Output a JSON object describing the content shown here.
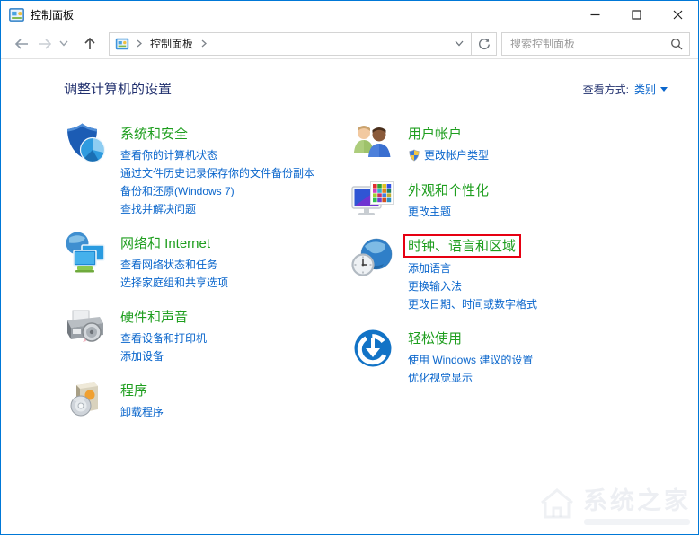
{
  "window": {
    "title": "控制面板"
  },
  "nav": {
    "breadcrumb_root": "控制面板",
    "search_placeholder": "搜索控制面板"
  },
  "header": {
    "title": "调整计算机的设置",
    "view_by_label": "查看方式:",
    "view_by_value": "类别"
  },
  "colors": {
    "accent_blue": "#0078d7",
    "category_green": "#1e9e1e",
    "link_blue": "#0a66cc",
    "heading_navy": "#21306e",
    "highlight_red": "#e60012"
  },
  "columns": {
    "left": [
      {
        "id": "system-security",
        "icon": "shield-security-icon",
        "title": "系统和安全",
        "links": [
          {
            "text": "查看你的计算机状态"
          },
          {
            "text": "通过文件历史记录保存你的文件备份副本"
          },
          {
            "text": "备份和还原(Windows 7)"
          },
          {
            "text": "查找并解决问题"
          }
        ]
      },
      {
        "id": "network-internet",
        "icon": "globe-monitors-icon",
        "title": "网络和 Internet",
        "links": [
          {
            "text": "查看网络状态和任务"
          },
          {
            "text": "选择家庭组和共享选项"
          }
        ]
      },
      {
        "id": "hardware-sound",
        "icon": "printer-speaker-icon",
        "title": "硬件和声音",
        "links": [
          {
            "text": "查看设备和打印机"
          },
          {
            "text": "添加设备"
          }
        ]
      },
      {
        "id": "programs",
        "icon": "software-disc-icon",
        "title": "程序",
        "links": [
          {
            "text": "卸载程序"
          }
        ]
      }
    ],
    "right": [
      {
        "id": "user-accounts",
        "icon": "two-users-icon",
        "title": "用户帐户",
        "links": [
          {
            "text": "更改帐户类型",
            "uac_shield": true
          }
        ]
      },
      {
        "id": "appearance-personalization",
        "icon": "monitor-palette-icon",
        "title": "外观和个性化",
        "links": [
          {
            "text": "更改主题"
          }
        ]
      },
      {
        "id": "clock-language-region",
        "icon": "globe-clock-icon",
        "title": "时钟、语言和区域",
        "highlighted": true,
        "links": [
          {
            "text": "添加语言"
          },
          {
            "text": "更换输入法"
          },
          {
            "text": "更改日期、时间或数字格式"
          }
        ]
      },
      {
        "id": "ease-of-access",
        "icon": "ease-of-access-icon",
        "title": "轻松使用",
        "links": [
          {
            "text": "使用 Windows 建议的设置"
          },
          {
            "text": "优化视觉显示"
          }
        ]
      }
    ]
  },
  "watermark": {
    "text": "系统之家"
  }
}
